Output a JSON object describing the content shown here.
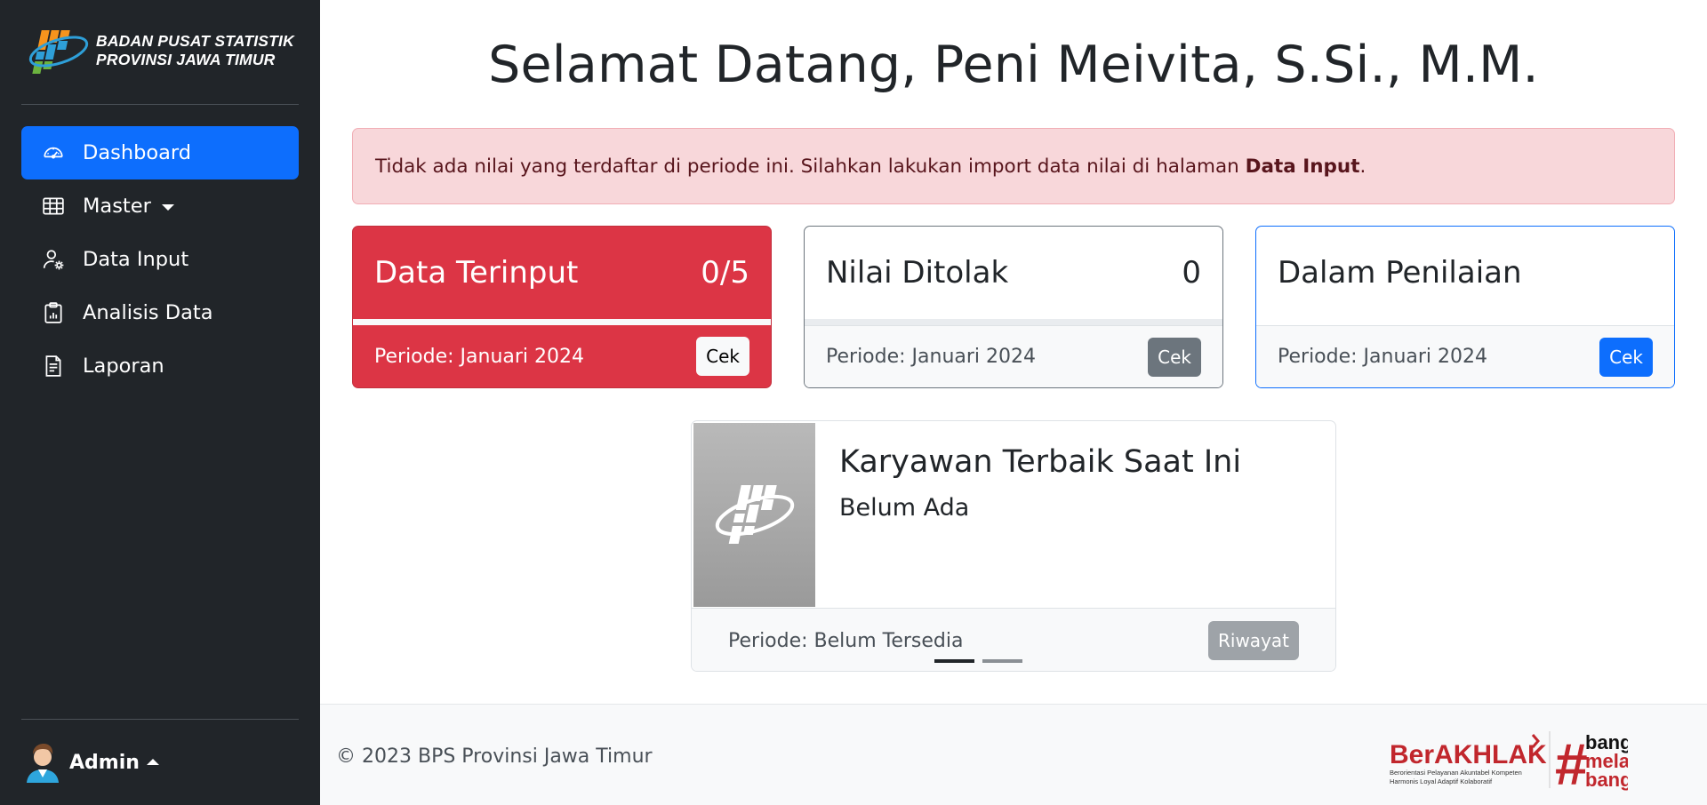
{
  "sidebar": {
    "brand": {
      "line1": "BADAN PUSAT STATISTIK",
      "line2": "PROVINSI JAWA TIMUR"
    },
    "items": [
      {
        "label": "Dashboard",
        "icon": "speedometer-icon",
        "active": true
      },
      {
        "label": "Master",
        "icon": "table-icon",
        "dropdown": true
      },
      {
        "label": "Data Input",
        "icon": "person-gear-icon"
      },
      {
        "label": "Analisis Data",
        "icon": "clipboard-data-icon"
      },
      {
        "label": "Laporan",
        "icon": "file-text-icon"
      }
    ],
    "user": {
      "name": "Admin",
      "icon": "user-avatar-icon"
    }
  },
  "main": {
    "title": "Selamat Datang, Peni Meivita, S.Si., M.M.",
    "alert": {
      "text": "Tidak ada nilai yang terdaftar di periode ini. Silahkan lakukan import data nilai di halaman ",
      "link": "Data Input",
      "end": "."
    },
    "cards": [
      {
        "title": "Data Terinput",
        "value": "0/5",
        "period": "Periode: Januari 2024",
        "button": "Cek",
        "color": "#dc3545"
      },
      {
        "title": "Nilai Ditolak",
        "value": "0",
        "period": "Periode: Januari 2024",
        "button": "Cek",
        "color": "#6c757d"
      },
      {
        "title": "Dalam Penilaian",
        "value": "",
        "period": "Periode: Januari 2024",
        "button": "Cek",
        "color": "#0d6efd"
      }
    ],
    "employee": {
      "title": "Karyawan Terbaik Saat Ini",
      "subtitle": "Belum Ada",
      "period": "Periode: Belum Tersedia",
      "button": "Riwayat"
    }
  },
  "footer": {
    "copyright": "© 2023 BPS Provinsi Jawa Timur",
    "logo": {
      "berakhlak": "BerAKHLAK",
      "tagline1": "Berorientasi Pelayanan Akuntabel Kompeten",
      "tagline2": "Harmonis Loyal Adaptif Kolaboratif",
      "bangga1": "bangga",
      "bangga2": "melayani",
      "bangga3": "bangsa"
    }
  }
}
